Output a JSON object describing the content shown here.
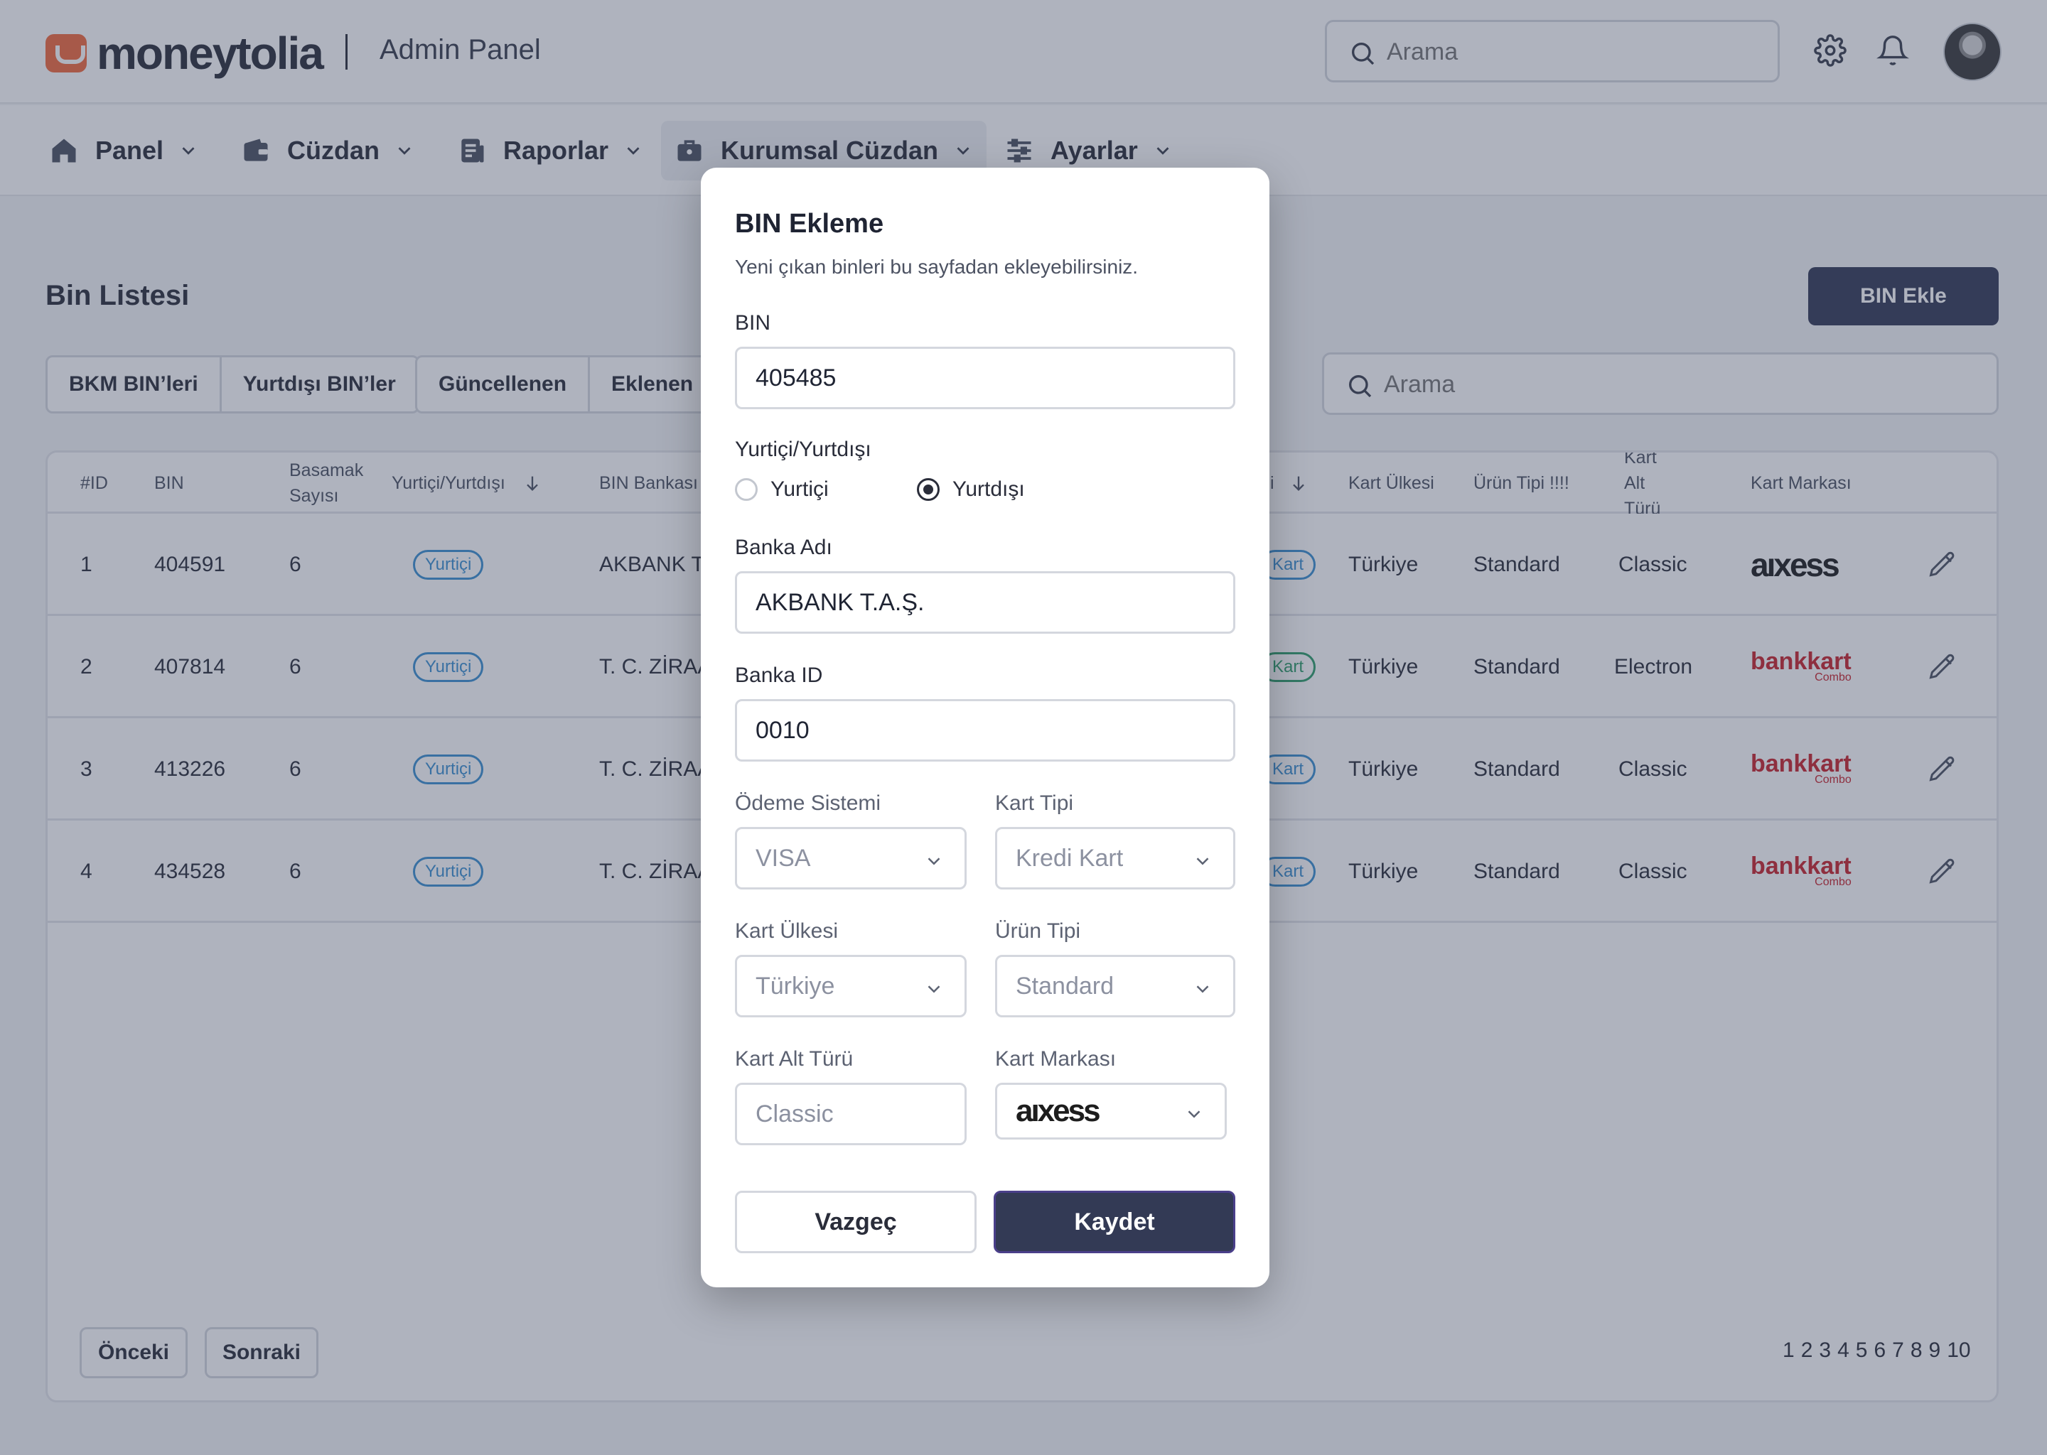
{
  "header": {
    "brand": "moneytolia",
    "app_title": "Admin Panel",
    "search_placeholder": "Arama"
  },
  "nav": {
    "items": [
      {
        "label": "Panel",
        "icon": "home-icon"
      },
      {
        "label": "Cüzdan",
        "icon": "wallet-icon"
      },
      {
        "label": "Raporlar",
        "icon": "report-icon"
      },
      {
        "label": "Kurumsal Cüzdan",
        "icon": "briefcase-icon",
        "active": true
      },
      {
        "label": "Ayarlar",
        "icon": "sliders-icon"
      }
    ]
  },
  "page": {
    "title": "Bin Listesi",
    "add_button": "BIN Ekle",
    "filters_left": [
      "BKM BIN’leri",
      "Yurtdışı BIN’ler"
    ],
    "filters_right": [
      "Güncellenen",
      "Eklenen"
    ],
    "search_placeholder": "Arama"
  },
  "table": {
    "columns": {
      "id": "#ID",
      "bin": "BIN",
      "digits": "Basamak Sayısı",
      "domestic": "Yurtiçi/Yurtdışı",
      "bank": "BIN Bankası",
      "card_type_partial": "i",
      "country": "Kart Ülkesi",
      "product": "Ürün Tipi !!!!",
      "subtype": "Kart Alt Türü",
      "brand": "Kart Markası"
    },
    "rows": [
      {
        "id": "1",
        "bin": "404591",
        "digits": "6",
        "domestic": "Yurtiçi",
        "bank": "AKBANK T.",
        "type_partial": "Kart",
        "country": "Türkiye",
        "product": "Standard",
        "subtype": "Classic",
        "brand": "axess"
      },
      {
        "id": "2",
        "bin": "407814",
        "digits": "6",
        "domestic": "Yurtiçi",
        "bank": "T. C. ZİRAA",
        "type_partial": "Kart",
        "country": "Türkiye",
        "product": "Standard",
        "subtype": "Electron",
        "brand": "bankkart"
      },
      {
        "id": "3",
        "bin": "413226",
        "digits": "6",
        "domestic": "Yurtiçi",
        "bank": "T. C. ZİRAA",
        "type_partial": "Kart",
        "country": "Türkiye",
        "product": "Standard",
        "subtype": "Classic",
        "brand": "bankkart"
      },
      {
        "id": "4",
        "bin": "434528",
        "digits": "6",
        "domestic": "Yurtiçi",
        "bank": "T. C. ZİRAA",
        "type_partial": "Kart",
        "country": "Türkiye",
        "product": "Standard",
        "subtype": "Classic",
        "brand": "bankkart"
      }
    ],
    "brand_logos": {
      "axess": "aıxess",
      "bankkart": "bankkart",
      "bankkart_sub": "Combo"
    }
  },
  "pagination": {
    "prev": "Önceki",
    "next": "Sonraki",
    "pages": [
      "1",
      "2",
      "3",
      "4",
      "5",
      "6",
      "7",
      "8",
      "9",
      "10"
    ]
  },
  "modal": {
    "title": "BIN Ekleme",
    "subtitle": "Yeni çıkan binleri bu sayfadan ekleyebilirsiniz.",
    "bin_label": "BIN",
    "bin_value": "405485",
    "domestic_label": "Yurtiçi/Yurtdışı",
    "radio_domestic": "Yurtiçi",
    "radio_foreign": "Yurtdışı",
    "radio_selected": "Yurtdışı",
    "bank_name_label": "Banka Adı",
    "bank_name_value": "AKBANK T.A.Ş.",
    "bank_id_label": "Banka ID",
    "bank_id_value": "0010",
    "payment_system_label": "Ödeme Sistemi",
    "payment_system_value": "VISA",
    "card_type_label": "Kart Tipi",
    "card_type_value": "Kredi Kart",
    "card_country_label": "Kart Ülkesi",
    "card_country_value": "Türkiye",
    "product_type_label": "Ürün Tipi",
    "product_type_value": "Standard",
    "card_subtype_label": "Kart Alt Türü",
    "card_subtype_placeholder": "Classic",
    "card_brand_label": "Kart Markası",
    "card_brand_value": "aıxess",
    "cancel_label": "Vazgeç",
    "save_label": "Kaydet"
  },
  "colors": {
    "primary": "#333a55",
    "brand_orange": "#f26a3d",
    "pill_blue": "#3b8fd1",
    "pill_green": "#2f9e6b",
    "bankkart_red": "#c8232c"
  }
}
